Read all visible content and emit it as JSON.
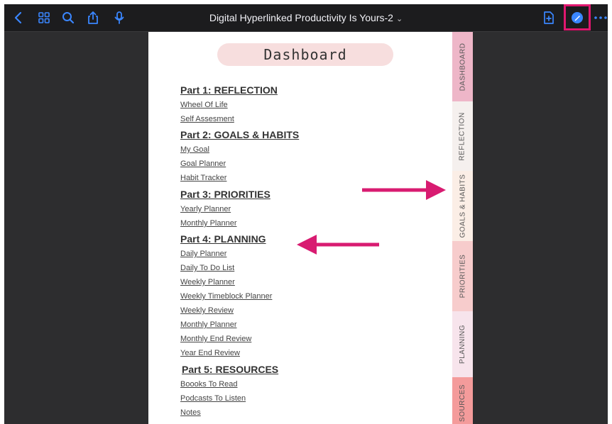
{
  "toolbar": {
    "title": "Digital Hyperlinked Productivity Is Yours-2",
    "title_chevron": "⌄",
    "left_icons": [
      "back-icon",
      "grid-icon",
      "search-icon",
      "share-icon",
      "microphone-icon"
    ],
    "right_icons": [
      "add-page-icon",
      "markup-pen-icon",
      "more-icon"
    ],
    "accent": "#3a86ff",
    "highlight": "#e0176f"
  },
  "page": {
    "heading": "Dashboard",
    "sections": [
      {
        "title": "Part 1: REFLECTION",
        "links": [
          "Wheel Of Life",
          "Self Assesment"
        ]
      },
      {
        "title": "Part 2: GOALS & HABITS",
        "links": [
          "My Goal",
          "Goal Planner",
          "Habit Tracker"
        ]
      },
      {
        "title": "Part 3: PRIORITIES",
        "links": [
          "Yearly Planner",
          "Monthly Planner"
        ]
      },
      {
        "title": "Part 4: PLANNING",
        "links": [
          "Daily Planner",
          "Daily To Do List",
          "Weekly Planner",
          "Weekly Timeblock Planner",
          "Weekly Review",
          "Monthly Planner",
          "Monthly End Review",
          "Year End Review"
        ]
      },
      {
        "title": "Part 5: RESOURCES",
        "links": [
          "Boooks To Read",
          "Podcasts To Listen",
          "Notes"
        ]
      }
    ]
  },
  "tabs": [
    {
      "label": "DASHBOARD",
      "color": "#eeb6c8"
    },
    {
      "label": "REFLECTION",
      "color": "#f5f0ee"
    },
    {
      "label": "GOALS & HABITS",
      "color": "#fbeee6"
    },
    {
      "label": "PRIORITIES",
      "color": "#f7cccc"
    },
    {
      "label": "PLANNING",
      "color": "#f7e4ec"
    },
    {
      "label": "SOURCES",
      "color": "#f49b9b"
    }
  ],
  "annotation_color": "#d81b71"
}
